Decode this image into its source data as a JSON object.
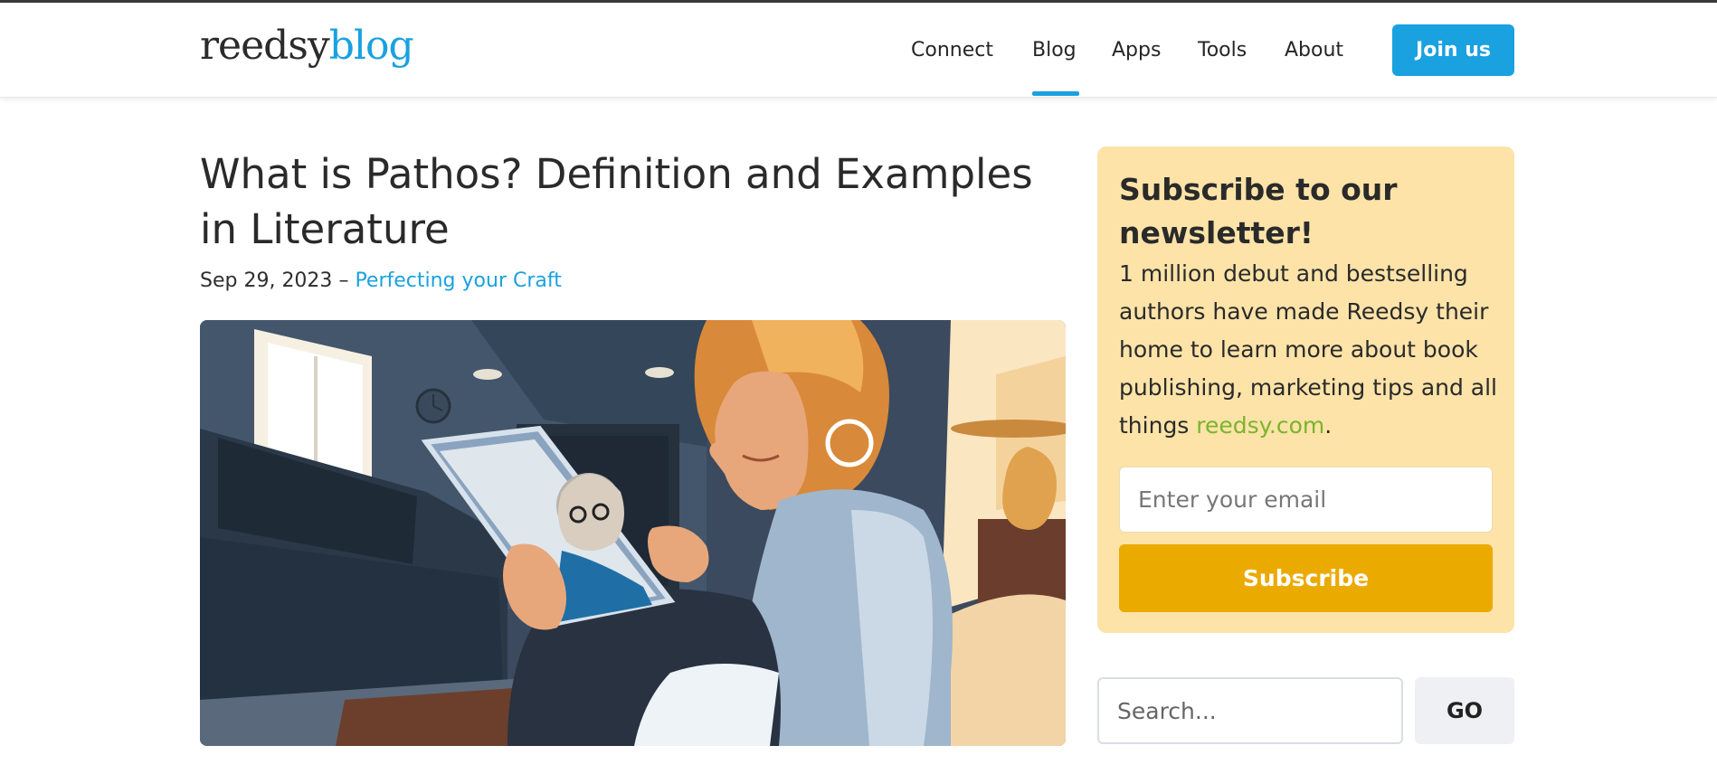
{
  "header": {
    "logo": {
      "brand": "reedsy",
      "product": "blog"
    },
    "nav": [
      {
        "label": "Connect"
      },
      {
        "label": "Blog"
      },
      {
        "label": "Apps"
      },
      {
        "label": "Tools"
      },
      {
        "label": "About"
      }
    ],
    "active_nav": "Blog",
    "join_label": "Join us"
  },
  "article": {
    "title": "What is Pathos? Definition and Examples in Literature",
    "date": "Sep 29, 2023",
    "separator": "–",
    "category": "Perfecting your Craft"
  },
  "newsletter": {
    "title": "Subscribe to our newsletter!",
    "text_before": "1 million debut and bestselling authors have made Reedsy their home to learn more about book publishing, marketing tips and all things",
    "link_text": "reedsy.com",
    "text_after": ".",
    "email_placeholder": "Enter your email",
    "subscribe_label": "Subscribe"
  },
  "search": {
    "placeholder": "Search...",
    "go_label": "GO"
  },
  "colors": {
    "accent": "#1aa1df",
    "newsletter_bg": "#fde3a8",
    "subscribe_btn": "#ebaa00",
    "link_green": "#7ab42c"
  }
}
